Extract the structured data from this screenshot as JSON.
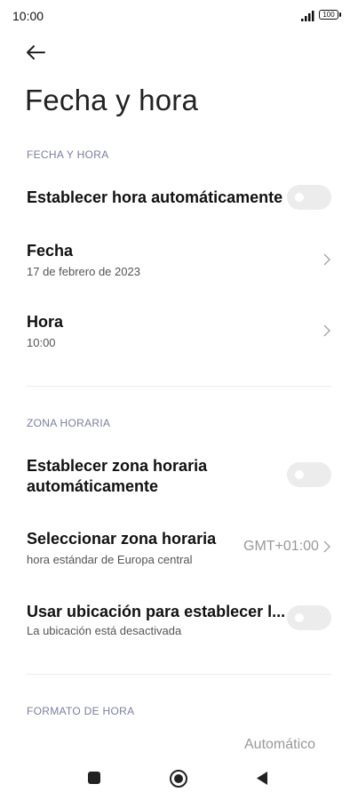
{
  "status_bar": {
    "time": "10:00",
    "battery": "100"
  },
  "page": {
    "title": "Fecha y hora"
  },
  "sections": {
    "date_time": {
      "header": "FECHA Y HORA",
      "auto_time": {
        "label": "Establecer hora automáticamente",
        "enabled": false
      },
      "date": {
        "label": "Fecha",
        "value": "17 de febrero de 2023"
      },
      "time": {
        "label": "Hora",
        "value": "10:00"
      }
    },
    "time_zone": {
      "header": "ZONA HORARIA",
      "auto_zone": {
        "label_line1": "Establecer zona horaria",
        "label_line2": "automáticamente",
        "enabled": false
      },
      "select_zone": {
        "label": "Seleccionar zona horaria",
        "sub": "hora estándar de Europa central",
        "value": "GMT+01:00"
      },
      "use_location": {
        "label": "Usar ubicación para establecer l...",
        "sub": "La ubicación está desactivada",
        "enabled": false
      }
    },
    "time_format": {
      "header": "FORMATO DE HORA",
      "value": "Automático"
    }
  },
  "icons": {
    "back": "arrow-left-icon",
    "chevron": "chevron-right-icon",
    "nav_recents": "square-icon",
    "nav_home": "circle-icon",
    "nav_back": "triangle-left-icon"
  }
}
